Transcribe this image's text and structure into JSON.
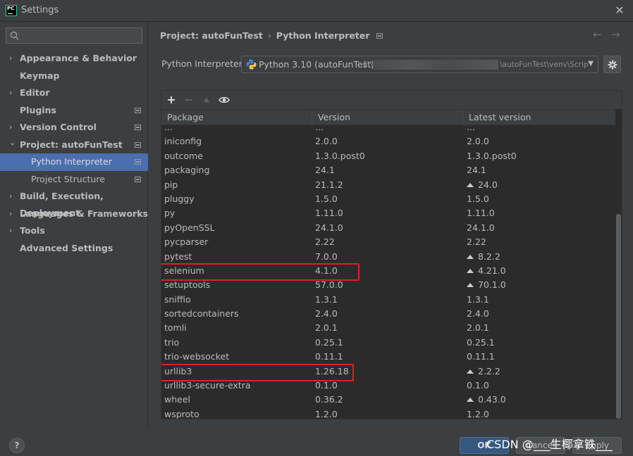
{
  "window": {
    "title": "Settings",
    "close_glyph": "✕"
  },
  "icons": [
    "pycharm-logo-icon",
    "search-icon",
    "close-icon",
    "chevron-right-icon",
    "chevron-down-icon",
    "project-scope-icon",
    "back-arrow-icon",
    "forward-arrow-icon",
    "python-icon",
    "dropdown-arrow-icon",
    "gear-icon",
    "add-icon",
    "remove-icon",
    "upgrade-icon",
    "eye-icon",
    "help-icon"
  ],
  "colors": {
    "selection": "#4b6eaf",
    "highlight_box": "#e02020",
    "ok_button": "#365880"
  },
  "search": {
    "placeholder": ""
  },
  "sidebar": {
    "items": [
      {
        "label": "Appearance & Behavior",
        "chevron": "›"
      },
      {
        "label": "Keymap",
        "chevron": ""
      },
      {
        "label": "Editor",
        "chevron": "›"
      },
      {
        "label": "Plugins",
        "chevron": ""
      },
      {
        "label": "Version Control",
        "chevron": "›"
      },
      {
        "label": "Project: autoFunTest",
        "chevron": "⌄"
      },
      {
        "label": "Python Interpreter",
        "chevron": ""
      },
      {
        "label": "Project Structure",
        "chevron": ""
      },
      {
        "label": "Build, Execution, Deployment",
        "chevron": "›"
      },
      {
        "label": "Languages & Frameworks",
        "chevron": "›"
      },
      {
        "label": "Tools",
        "chevron": "›"
      },
      {
        "label": "Advanced Settings",
        "chevron": ""
      }
    ],
    "selected": "Python Interpreter"
  },
  "breadcrumb": {
    "project": "Project: autoFunTest",
    "separator": "›",
    "page": "Python Interpreter"
  },
  "nav": {
    "back": "←",
    "forward": "→"
  },
  "interpreter": {
    "label": "Python Interpreter:",
    "name": "Python 3.10 (autoFunTest)",
    "path_start": "E:\\",
    "path_end": "\\autoFunTest\\venv\\Scrip",
    "dropdown": "▼"
  },
  "toolbar": {
    "add": "+",
    "remove": "−",
    "upgrade": "▲"
  },
  "table": {
    "headers": {
      "package": "Package",
      "version": "Version",
      "latest": "Latest version"
    },
    "rows": [
      {
        "package": "...",
        "version": "...",
        "latest": "...",
        "upgrade": false
      },
      {
        "package": "iniconfig",
        "version": "2.0.0",
        "latest": "2.0.0",
        "upgrade": false
      },
      {
        "package": "outcome",
        "version": "1.3.0.post0",
        "latest": "1.3.0.post0",
        "upgrade": false
      },
      {
        "package": "packaging",
        "version": "24.1",
        "latest": "24.1",
        "upgrade": false
      },
      {
        "package": "pip",
        "version": "21.1.2",
        "latest": "24.0",
        "upgrade": true
      },
      {
        "package": "pluggy",
        "version": "1.5.0",
        "latest": "1.5.0",
        "upgrade": false
      },
      {
        "package": "py",
        "version": "1.11.0",
        "latest": "1.11.0",
        "upgrade": false
      },
      {
        "package": "pyOpenSSL",
        "version": "24.1.0",
        "latest": "24.1.0",
        "upgrade": false
      },
      {
        "package": "pycparser",
        "version": "2.22",
        "latest": "2.22",
        "upgrade": false
      },
      {
        "package": "pytest",
        "version": "7.0.0",
        "latest": "8.2.2",
        "upgrade": true
      },
      {
        "package": "selenium",
        "version": "4.1.0",
        "latest": "4.21.0",
        "upgrade": true,
        "highlighted": true
      },
      {
        "package": "setuptools",
        "version": "57.0.0",
        "latest": "70.1.0",
        "upgrade": true
      },
      {
        "package": "sniffio",
        "version": "1.3.1",
        "latest": "1.3.1",
        "upgrade": false
      },
      {
        "package": "sortedcontainers",
        "version": "2.4.0",
        "latest": "2.4.0",
        "upgrade": false
      },
      {
        "package": "tomli",
        "version": "2.0.1",
        "latest": "2.0.1",
        "upgrade": false
      },
      {
        "package": "trio",
        "version": "0.25.1",
        "latest": "0.25.1",
        "upgrade": false
      },
      {
        "package": "trio-websocket",
        "version": "0.11.1",
        "latest": "0.11.1",
        "upgrade": false
      },
      {
        "package": "urllib3",
        "version": "1.26.18",
        "latest": "2.2.2",
        "upgrade": true,
        "highlighted": true
      },
      {
        "package": "urllib3-secure-extra",
        "version": "0.1.0",
        "latest": "0.1.0",
        "upgrade": false
      },
      {
        "package": "wheel",
        "version": "0.36.2",
        "latest": "0.43.0",
        "upgrade": true
      },
      {
        "package": "wsproto",
        "version": "1.2.0",
        "latest": "1.2.0",
        "upgrade": false
      }
    ]
  },
  "buttons": {
    "help": "?",
    "ok": "OK",
    "cancel": "Cancel",
    "apply": "Apply"
  },
  "watermark": "CSDN @___生椰拿铁___"
}
